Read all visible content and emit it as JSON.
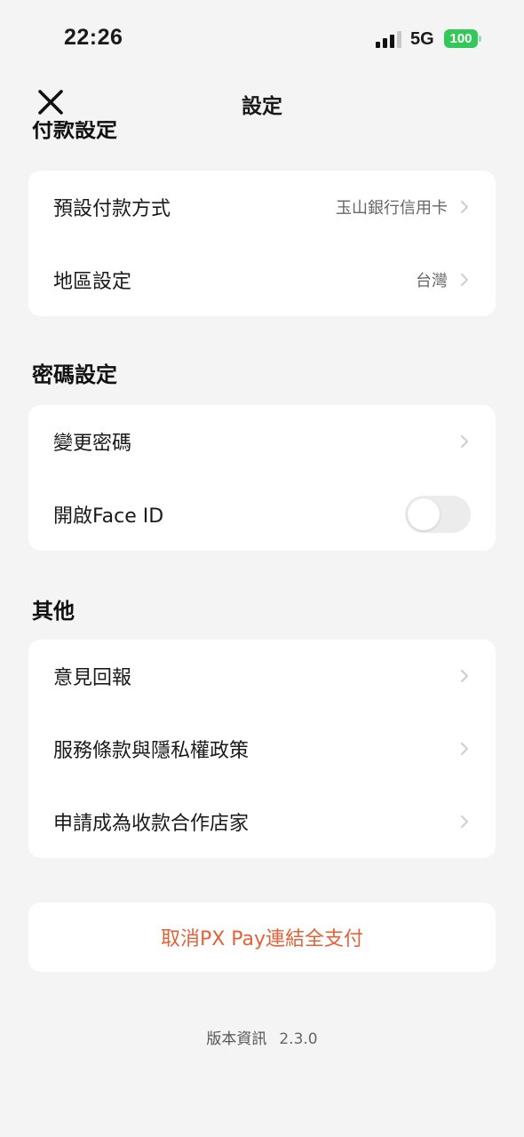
{
  "status_bar": {
    "time": "22:26",
    "network": "5G",
    "battery": "100"
  },
  "header": {
    "title": "設定"
  },
  "sections": {
    "payment": {
      "title": "付款設定",
      "default_payment_label": "預設付款方式",
      "default_payment_value": "玉山銀行信用卡",
      "region_label": "地區設定",
      "region_value": "台灣"
    },
    "password": {
      "title": "密碼設定",
      "change_password_label": "變更密碼",
      "face_id_label": "開啟Face ID",
      "face_id_enabled": false
    },
    "other": {
      "title": "其他",
      "feedback_label": "意見回報",
      "terms_label": "服務條款與隱私權政策",
      "merchant_label": "申請成為收款合作店家"
    }
  },
  "cancel": {
    "label": "取消PX Pay連結全支付"
  },
  "version": {
    "label": "版本資訊",
    "number": "2.3.0"
  },
  "colors": {
    "background": "#f4f4f5",
    "card": "#ffffff",
    "danger_text": "#e0633a",
    "battery": "#34c759"
  }
}
